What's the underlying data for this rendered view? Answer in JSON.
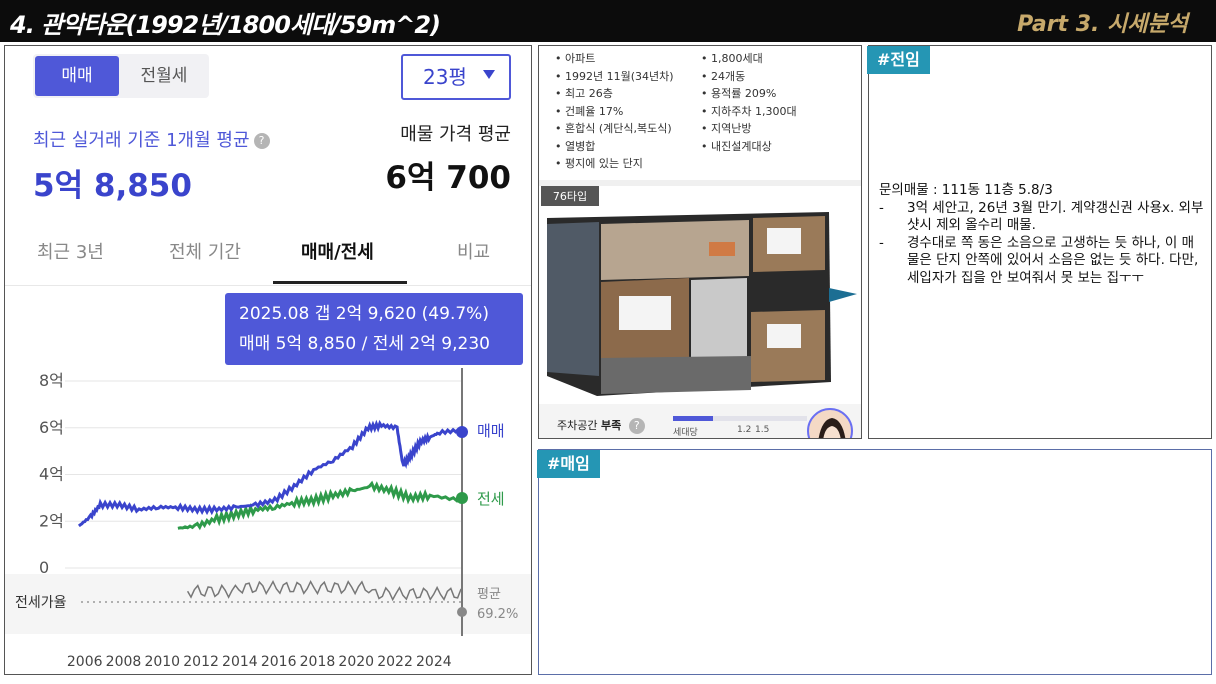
{
  "header": {
    "title": "4. 관악타운(1992년/1800세대/59m^2)",
    "part": "Part 3. 시세분석"
  },
  "left": {
    "seg_on": "매매",
    "seg_off": "전월세",
    "size": "23평",
    "recent_label": "최근 실거래 기준 1개월 평균",
    "recent_price": "5억 8,850",
    "listing_label": "매물 가격 평균",
    "listing_price": "6억 700",
    "tabs": [
      "최근 3년",
      "전체 기간",
      "매매/전세",
      "비교"
    ],
    "tooltip_line1": "2025.08  갭 2억 9,620 (49.7%)",
    "tooltip_line2": "매매 5억 8,850 / 전세 2억 9,230"
  },
  "chart_data": {
    "type": "line",
    "x": [
      2006,
      2008,
      2010,
      2012,
      2014,
      2016,
      2018,
      2020,
      2022,
      2024
    ],
    "y_ticks": [
      "8억",
      "6억",
      "4억",
      "2억",
      "0"
    ],
    "ylim": [
      0,
      8
    ],
    "series": [
      {
        "name": "매매",
        "color": "#3a44cc",
        "points": [
          [
            2005.9,
            1.8
          ],
          [
            2006.5,
            2.2
          ],
          [
            2007,
            2.7
          ],
          [
            2008,
            2.7
          ],
          [
            2009,
            2.5
          ],
          [
            2010,
            2.6
          ],
          [
            2011,
            2.6
          ],
          [
            2012,
            2.5
          ],
          [
            2013,
            2.5
          ],
          [
            2014,
            2.6
          ],
          [
            2015,
            2.7
          ],
          [
            2016,
            2.9
          ],
          [
            2017,
            3.5
          ],
          [
            2018,
            4.2
          ],
          [
            2019,
            4.6
          ],
          [
            2020,
            5.2
          ],
          [
            2020.8,
            6.0
          ],
          [
            2021.5,
            6.1
          ],
          [
            2022.3,
            6.0
          ],
          [
            2022.6,
            4.4
          ],
          [
            2023,
            4.8
          ],
          [
            2023.5,
            5.4
          ],
          [
            2024,
            5.6
          ],
          [
            2024.5,
            5.8
          ],
          [
            2025.6,
            5.9
          ]
        ]
      },
      {
        "name": "전세",
        "color": "#2e9a4a",
        "points": [
          [
            2011,
            1.7
          ],
          [
            2012,
            1.8
          ],
          [
            2013,
            2.1
          ],
          [
            2014,
            2.3
          ],
          [
            2015,
            2.5
          ],
          [
            2016,
            2.6
          ],
          [
            2017,
            2.8
          ],
          [
            2018,
            2.9
          ],
          [
            2019,
            3.1
          ],
          [
            2020,
            3.3
          ],
          [
            2021,
            3.5
          ],
          [
            2022,
            3.3
          ],
          [
            2023,
            3.0
          ],
          [
            2024,
            3.1
          ],
          [
            2025.6,
            2.9
          ]
        ]
      }
    ],
    "ratio_label": "전세가율",
    "avg_label": "평균",
    "avg_value": "69.2%"
  },
  "middle": {
    "info_left": [
      "아파트",
      "1992년 11월(34년차)",
      "최고 26층",
      "건폐율 17%",
      "혼합식 (계단식,복도식)",
      "열병합",
      "평지에 있는 단지"
    ],
    "info_right": [
      "1,800세대",
      "24개동",
      "용적률 209%",
      "지하주차 1,300대",
      "지역난방",
      "내진설계대상"
    ],
    "floor_type": "76타입",
    "parking_label": "주차공간",
    "parking_status": "부족",
    "parking_ticks": [
      "세대당",
      "1.2",
      "1.5"
    ]
  },
  "right_top": {
    "tag": "#전임",
    "lines": {
      "head": "문의매물 : 111동 11층 5.8/3",
      "items": [
        "3억 세안고, 26년 3월 만기. 계약갱신권 사용x. 외부 샷시 제외 올수리 매물.",
        "경수대로 쪽 동은 소음으로 고생하는 듯 하나, 이 매물은 단지 안쪽에 있어서 소음은 없는 듯 하다. 다만, 세입자가 집을 안 보여줘서 못 보는 집ㅜㅜ"
      ]
    }
  },
  "right_bottom": {
    "tag": "#매임"
  }
}
